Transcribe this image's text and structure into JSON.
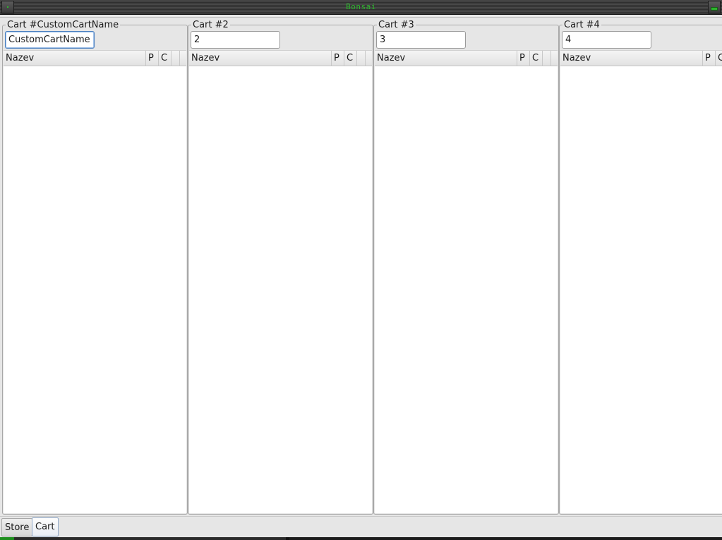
{
  "window": {
    "title": "Bonsai"
  },
  "carts": [
    {
      "legend": "Cart #CustomCartName",
      "input_value": "CustomCartName",
      "focused": true,
      "columns": [
        "Nazev",
        "P",
        "C",
        ""
      ]
    },
    {
      "legend": "Cart #2",
      "input_value": "2",
      "focused": false,
      "columns": [
        "Nazev",
        "P",
        "C",
        ""
      ]
    },
    {
      "legend": "Cart #3",
      "input_value": "3",
      "focused": false,
      "columns": [
        "Nazev",
        "P",
        "C",
        ""
      ]
    },
    {
      "legend": "Cart #4",
      "input_value": "4",
      "focused": false,
      "columns": [
        "Nazev",
        "P",
        "C"
      ]
    }
  ],
  "tabs": [
    {
      "label": "Store",
      "active": false
    },
    {
      "label": "Cart",
      "active": true
    }
  ]
}
